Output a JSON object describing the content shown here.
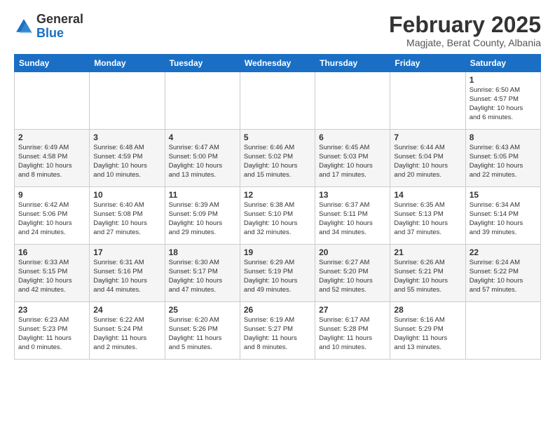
{
  "logo": {
    "general": "General",
    "blue": "Blue"
  },
  "title": "February 2025",
  "location": "Magjate, Berat County, Albania",
  "days_of_week": [
    "Sunday",
    "Monday",
    "Tuesday",
    "Wednesday",
    "Thursday",
    "Friday",
    "Saturday"
  ],
  "weeks": [
    [
      {
        "day": "",
        "info": ""
      },
      {
        "day": "",
        "info": ""
      },
      {
        "day": "",
        "info": ""
      },
      {
        "day": "",
        "info": ""
      },
      {
        "day": "",
        "info": ""
      },
      {
        "day": "",
        "info": ""
      },
      {
        "day": "1",
        "info": "Sunrise: 6:50 AM\nSunset: 4:57 PM\nDaylight: 10 hours\nand 6 minutes."
      }
    ],
    [
      {
        "day": "2",
        "info": "Sunrise: 6:49 AM\nSunset: 4:58 PM\nDaylight: 10 hours\nand 8 minutes."
      },
      {
        "day": "3",
        "info": "Sunrise: 6:48 AM\nSunset: 4:59 PM\nDaylight: 10 hours\nand 10 minutes."
      },
      {
        "day": "4",
        "info": "Sunrise: 6:47 AM\nSunset: 5:00 PM\nDaylight: 10 hours\nand 13 minutes."
      },
      {
        "day": "5",
        "info": "Sunrise: 6:46 AM\nSunset: 5:02 PM\nDaylight: 10 hours\nand 15 minutes."
      },
      {
        "day": "6",
        "info": "Sunrise: 6:45 AM\nSunset: 5:03 PM\nDaylight: 10 hours\nand 17 minutes."
      },
      {
        "day": "7",
        "info": "Sunrise: 6:44 AM\nSunset: 5:04 PM\nDaylight: 10 hours\nand 20 minutes."
      },
      {
        "day": "8",
        "info": "Sunrise: 6:43 AM\nSunset: 5:05 PM\nDaylight: 10 hours\nand 22 minutes."
      }
    ],
    [
      {
        "day": "9",
        "info": "Sunrise: 6:42 AM\nSunset: 5:06 PM\nDaylight: 10 hours\nand 24 minutes."
      },
      {
        "day": "10",
        "info": "Sunrise: 6:40 AM\nSunset: 5:08 PM\nDaylight: 10 hours\nand 27 minutes."
      },
      {
        "day": "11",
        "info": "Sunrise: 6:39 AM\nSunset: 5:09 PM\nDaylight: 10 hours\nand 29 minutes."
      },
      {
        "day": "12",
        "info": "Sunrise: 6:38 AM\nSunset: 5:10 PM\nDaylight: 10 hours\nand 32 minutes."
      },
      {
        "day": "13",
        "info": "Sunrise: 6:37 AM\nSunset: 5:11 PM\nDaylight: 10 hours\nand 34 minutes."
      },
      {
        "day": "14",
        "info": "Sunrise: 6:35 AM\nSunset: 5:13 PM\nDaylight: 10 hours\nand 37 minutes."
      },
      {
        "day": "15",
        "info": "Sunrise: 6:34 AM\nSunset: 5:14 PM\nDaylight: 10 hours\nand 39 minutes."
      }
    ],
    [
      {
        "day": "16",
        "info": "Sunrise: 6:33 AM\nSunset: 5:15 PM\nDaylight: 10 hours\nand 42 minutes."
      },
      {
        "day": "17",
        "info": "Sunrise: 6:31 AM\nSunset: 5:16 PM\nDaylight: 10 hours\nand 44 minutes."
      },
      {
        "day": "18",
        "info": "Sunrise: 6:30 AM\nSunset: 5:17 PM\nDaylight: 10 hours\nand 47 minutes."
      },
      {
        "day": "19",
        "info": "Sunrise: 6:29 AM\nSunset: 5:19 PM\nDaylight: 10 hours\nand 49 minutes."
      },
      {
        "day": "20",
        "info": "Sunrise: 6:27 AM\nSunset: 5:20 PM\nDaylight: 10 hours\nand 52 minutes."
      },
      {
        "day": "21",
        "info": "Sunrise: 6:26 AM\nSunset: 5:21 PM\nDaylight: 10 hours\nand 55 minutes."
      },
      {
        "day": "22",
        "info": "Sunrise: 6:24 AM\nSunset: 5:22 PM\nDaylight: 10 hours\nand 57 minutes."
      }
    ],
    [
      {
        "day": "23",
        "info": "Sunrise: 6:23 AM\nSunset: 5:23 PM\nDaylight: 11 hours\nand 0 minutes."
      },
      {
        "day": "24",
        "info": "Sunrise: 6:22 AM\nSunset: 5:24 PM\nDaylight: 11 hours\nand 2 minutes."
      },
      {
        "day": "25",
        "info": "Sunrise: 6:20 AM\nSunset: 5:26 PM\nDaylight: 11 hours\nand 5 minutes."
      },
      {
        "day": "26",
        "info": "Sunrise: 6:19 AM\nSunset: 5:27 PM\nDaylight: 11 hours\nand 8 minutes."
      },
      {
        "day": "27",
        "info": "Sunrise: 6:17 AM\nSunset: 5:28 PM\nDaylight: 11 hours\nand 10 minutes."
      },
      {
        "day": "28",
        "info": "Sunrise: 6:16 AM\nSunset: 5:29 PM\nDaylight: 11 hours\nand 13 minutes."
      },
      {
        "day": "",
        "info": ""
      }
    ]
  ]
}
